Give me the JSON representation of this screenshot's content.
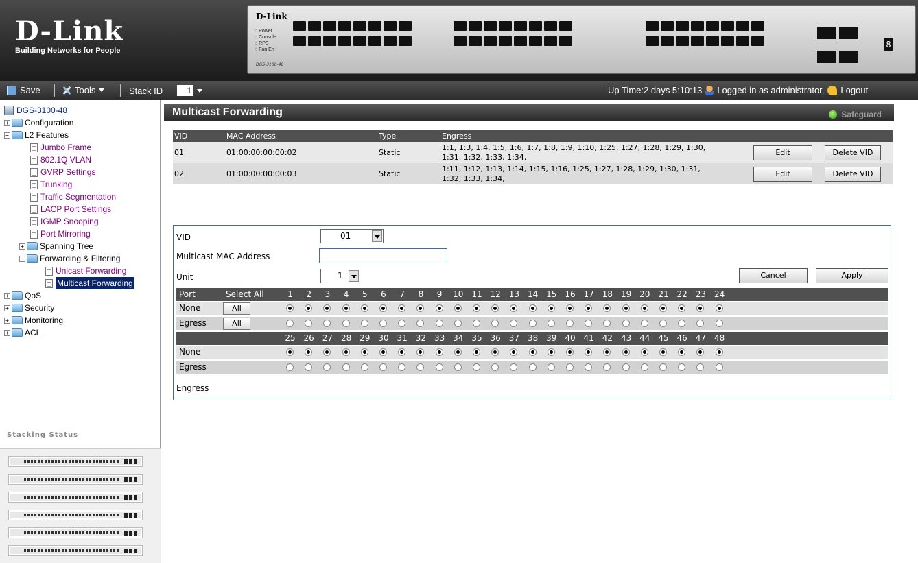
{
  "header": {
    "brand": "D-Link",
    "tagline": "Building Networks for People",
    "device": {
      "brand": "D-Link",
      "leds": [
        "Power",
        "Console",
        "RPS",
        "Fan Err"
      ],
      "model": "DGS-3100-48",
      "digit": "8"
    }
  },
  "toolbar": {
    "save_label": "Save",
    "tools_label": "Tools",
    "stack_id_label": "Stack ID",
    "stack_id_value": "1",
    "uptime": "Up Time:2 days 5:10:13",
    "logged_in": "Logged in as administrator,",
    "logout_label": "Logout"
  },
  "tree": {
    "root": "DGS-3100-48",
    "configuration": "Configuration",
    "l2_features": "L2 Features",
    "l2_items": [
      "Jumbo Frame",
      "802.1Q VLAN",
      "GVRP Settings",
      "Trunking",
      "Traffic Segmentation",
      "LACP Port Settings",
      "IGMP Snooping",
      "Port Mirroring"
    ],
    "spanning_tree": "Spanning Tree",
    "forwarding_filtering": "Forwarding & Filtering",
    "unicast": "Unicast Forwarding",
    "multicast": "Multicast Forwarding",
    "qos": "QoS",
    "security": "Security",
    "monitoring": "Monitoring",
    "acl": "ACL"
  },
  "stacking_status": {
    "label": "Stacking Status",
    "unit_count": 6
  },
  "page": {
    "title": "Multicast Forwarding",
    "safeguard": "Safeguard"
  },
  "table": {
    "headers": {
      "vid": "VID",
      "mac": "MAC Address",
      "type": "Type",
      "egress": "Engress"
    },
    "rows": [
      {
        "vid": "01",
        "mac": "01:00:00:00:00:02",
        "type": "Static",
        "egress_line1": "1:1, 1:3, 1:4, 1:5, 1:6, 1:7, 1:8, 1:9, 1:10, 1:25, 1:27, 1:28, 1:29, 1:30,",
        "egress_line2": "1:31, 1:32, 1:33, 1:34,"
      },
      {
        "vid": "02",
        "mac": "01:00:00:00:00:03",
        "type": "Static",
        "egress_line1": "1:11, 1:12, 1:13, 1:14, 1:15, 1:16, 1:25, 1:27, 1:28, 1:29, 1:30, 1:31,",
        "egress_line2": "1:32, 1:33, 1:34,"
      }
    ],
    "edit_label": "Edit",
    "delete_label": "Delete VID"
  },
  "form": {
    "vid_label": "VID",
    "vid_value": "01",
    "mac_label": "Multicast MAC Address",
    "mac_value": "",
    "unit_label": "Unit",
    "unit_value": "1",
    "cancel_label": "Cancel",
    "apply_label": "Apply",
    "port_label": "Port",
    "select_all_label": "Select All",
    "all_label": "All",
    "none_label": "None",
    "egress_label": "Egress",
    "ports_row1": [
      "1",
      "2",
      "3",
      "4",
      "5",
      "6",
      "7",
      "8",
      "9",
      "10",
      "11",
      "12",
      "13",
      "14",
      "15",
      "16",
      "17",
      "18",
      "19",
      "20",
      "21",
      "22",
      "23",
      "24"
    ],
    "ports_row2": [
      "25",
      "26",
      "27",
      "28",
      "29",
      "30",
      "31",
      "32",
      "33",
      "34",
      "35",
      "36",
      "37",
      "38",
      "39",
      "40",
      "41",
      "42",
      "43",
      "44",
      "45",
      "46",
      "47",
      "48"
    ],
    "selected": "None",
    "footer_label": "Engress"
  }
}
